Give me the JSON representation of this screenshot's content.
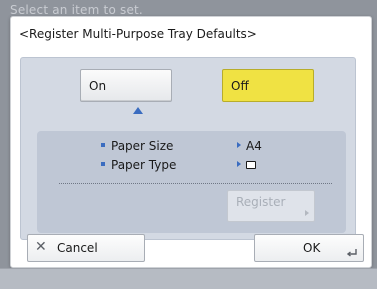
{
  "backdrop": {
    "title": "Select an item to set."
  },
  "dialog": {
    "title": "<Register Multi-Purpose Tray Defaults>"
  },
  "toggle": {
    "on_label": "On",
    "off_label": "Off",
    "selected": "Off",
    "selected_color": "#f0e243"
  },
  "info": {
    "rows": [
      {
        "label": "Paper Size",
        "value": "A4"
      },
      {
        "label": "Paper Type",
        "value_icon": "paper-icon"
      }
    ],
    "register_label": "Register",
    "register_enabled": false
  },
  "footer": {
    "cancel_label": "Cancel",
    "cancel_icon": "close-icon",
    "ok_label": "OK",
    "ok_icon": "enter-icon"
  },
  "colors": {
    "accent": "#3a6cc0",
    "panel": "#d3d9e3"
  }
}
